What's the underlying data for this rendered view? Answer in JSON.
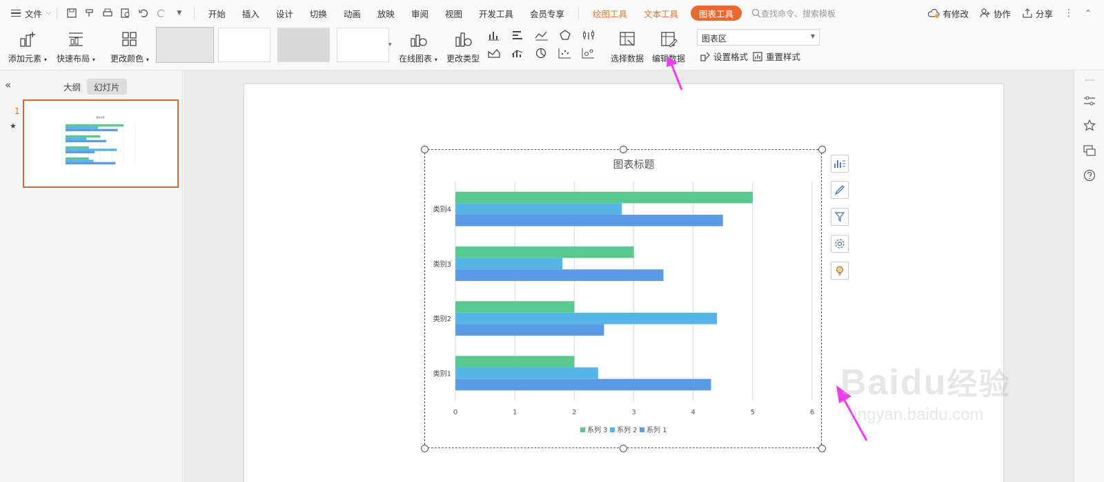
{
  "menubar": {
    "file_label": "文件",
    "tabs": [
      "开始",
      "插入",
      "设计",
      "切换",
      "动画",
      "放映",
      "审阅",
      "视图",
      "开发工具",
      "会员专享"
    ],
    "context_tabs": {
      "drawing": "绘图工具",
      "text": "文本工具",
      "chart": "图表工具"
    },
    "search_placeholder": "查找命令、搜索模板",
    "has_changes": "有修改",
    "collaborate": "协作",
    "share": "分享"
  },
  "ribbon": {
    "add_element": "添加元素",
    "quick_layout": "快速布局",
    "change_color": "更改颜色",
    "online_chart": "在线图表",
    "change_type": "更改类型",
    "select_data": "选择数据",
    "edit_data": "编辑数据",
    "chart_area_select": "图表区",
    "set_format": "设置格式",
    "reset_style": "重置样式"
  },
  "left_panel": {
    "outline_tab": "大纲",
    "slides_tab": "幻灯片",
    "slide_number": "1"
  },
  "colors": {
    "series1": "#5b9be6",
    "series2": "#58b4e7",
    "series3": "#5ac98f",
    "accent_orange": "#e8742a",
    "annotation": "#f23af2"
  },
  "chart_data": {
    "type": "bar",
    "orientation": "horizontal",
    "title": "图表标题",
    "categories": [
      "类别1",
      "类别2",
      "类别3",
      "类别4"
    ],
    "series": [
      {
        "name": "系列 1",
        "values": [
          4.3,
          2.5,
          3.5,
          4.5
        ]
      },
      {
        "name": "系列 2",
        "values": [
          2.4,
          4.4,
          1.8,
          2.8
        ]
      },
      {
        "name": "系列 3",
        "values": [
          2,
          2,
          3,
          5
        ]
      }
    ],
    "xlim": [
      0,
      6
    ],
    "xticks": [
      "0",
      "1",
      "2",
      "3",
      "4",
      "5",
      "6"
    ],
    "grid": true,
    "legend_position": "bottom",
    "legend": [
      "系列 3",
      "系列 2",
      "系列 1"
    ]
  },
  "watermark": {
    "brand": "Baidu",
    "cn": "经验",
    "url": "jingyan.baidu.com"
  }
}
